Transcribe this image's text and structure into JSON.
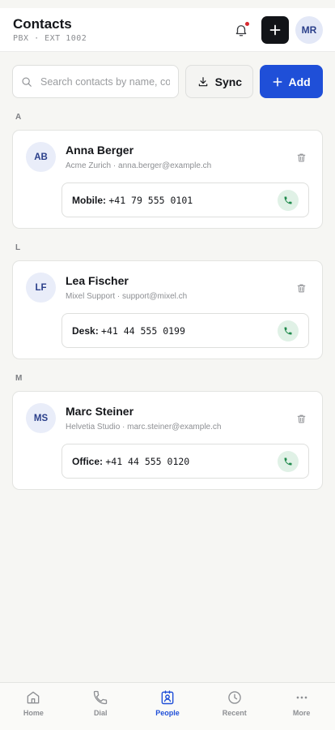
{
  "header": {
    "title": "Contacts",
    "subtitle": "PBX · EXT 1002",
    "avatar_initials": "MR"
  },
  "search": {
    "placeholder": "Search contacts by name, company, or number",
    "value": ""
  },
  "toolbar": {
    "sync_label": "Sync",
    "add_label": "Add"
  },
  "sections": [
    {
      "letter": "A",
      "contact": {
        "initials": "AB",
        "name": "Anna Berger",
        "meta": "Acme Zurich · anna.berger@example.ch",
        "phone_label": "Mobile:",
        "phone_number": "+41 79 555 0101"
      }
    },
    {
      "letter": "L",
      "contact": {
        "initials": "LF",
        "name": "Lea Fischer",
        "meta": "Mixel Support · support@mixel.ch",
        "phone_label": "Desk:",
        "phone_number": "+41 44 555 0199"
      }
    },
    {
      "letter": "M",
      "contact": {
        "initials": "MS",
        "name": "Marc Steiner",
        "meta": "Helvetia Studio · marc.steiner@example.ch",
        "phone_label": "Office:",
        "phone_number": "+41 44 555 0120"
      }
    }
  ],
  "nav": {
    "items": [
      {
        "label": "Home",
        "icon": "home-icon"
      },
      {
        "label": "Dial",
        "icon": "phone-icon"
      },
      {
        "label": "People",
        "icon": "contacts-icon",
        "active": true
      },
      {
        "label": "Recent",
        "icon": "clock-icon"
      },
      {
        "label": "More",
        "icon": "more-icon"
      }
    ]
  },
  "colors": {
    "accent": "#1f4fd8",
    "dark_button": "#121418",
    "notification_dot": "#d7282f",
    "call_green": "#1f8a4c"
  }
}
